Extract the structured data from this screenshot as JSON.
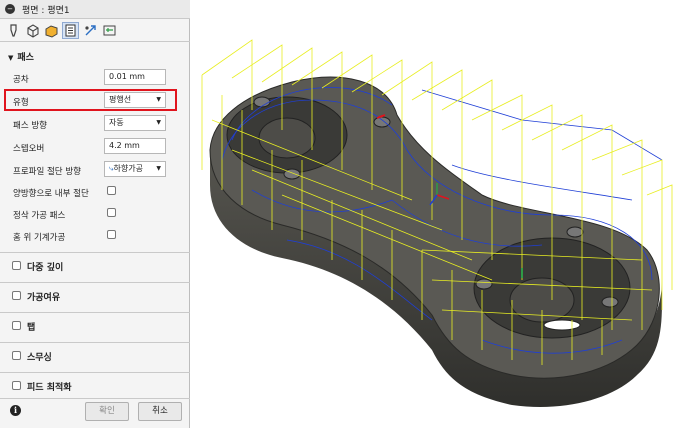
{
  "dialog": {
    "title": "평면 : 평면1",
    "tabs": [
      "tool-icon",
      "geometry-icon",
      "heights-icon",
      "passes-icon",
      "linking-icon",
      "post-icon"
    ]
  },
  "passes_section": {
    "header": "패스",
    "tolerance": {
      "label": "공차",
      "value": "0.01 mm"
    },
    "type": {
      "label": "유형",
      "value": "평행선"
    },
    "pass_direction": {
      "label": "패스 방향",
      "value": "자동"
    },
    "stepover": {
      "label": "스텝오버",
      "value": "4.2 mm"
    },
    "profile_cut": {
      "label": "프로파일 절단 방향",
      "value": "하향가공"
    },
    "both_ways": {
      "label": "양방향으로 내부 절단"
    },
    "finishing": {
      "label": "정삭 가공 패스"
    },
    "machine_top": {
      "label": "홈 위 기계가공"
    }
  },
  "groups": [
    "다중 깊이",
    "가공여유",
    "탭",
    "스무싱",
    "피드 최적화"
  ],
  "footer": {
    "ok": "확인",
    "cancel": "취소"
  },
  "colors": {
    "highlight": "#e0141d",
    "toolpath_yellow": "#e8ee23",
    "toolpath_blue": "#1f3fd6",
    "part": "#4a4a47"
  }
}
